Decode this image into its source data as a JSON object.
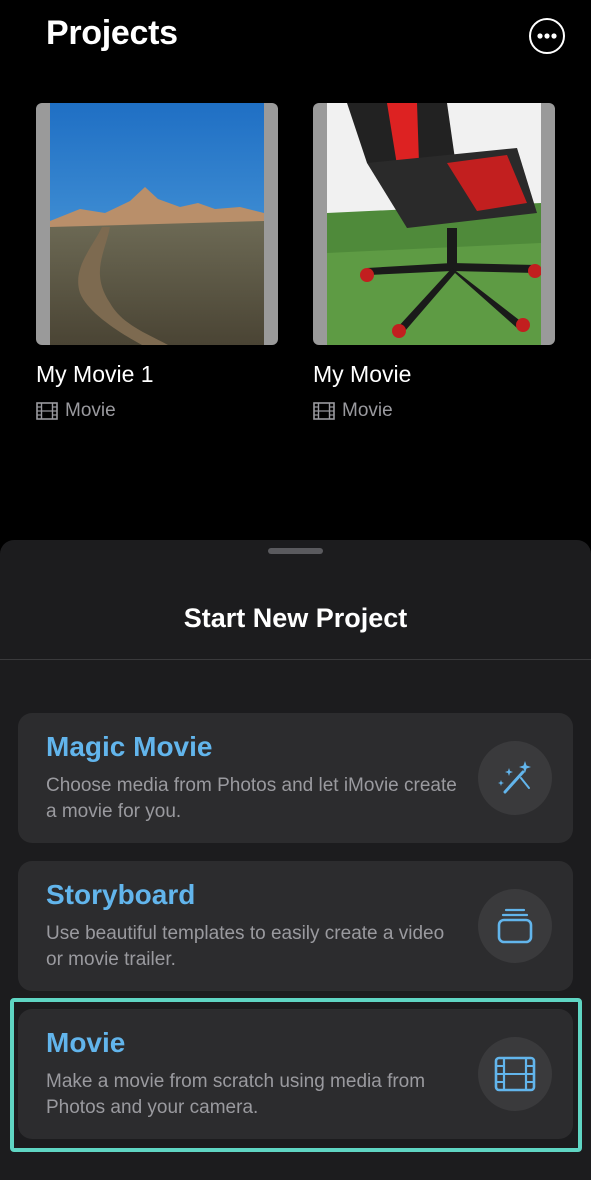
{
  "header": {
    "title": "Projects"
  },
  "projects": [
    {
      "name": "My Movie 1",
      "type": "Movie"
    },
    {
      "name": "My Movie",
      "type": "Movie"
    }
  ],
  "sheet": {
    "title": "Start New Project",
    "options": [
      {
        "title": "Magic Movie",
        "description": "Choose media from Photos and let iMovie create a movie for you.",
        "icon": "magic-wand-icon"
      },
      {
        "title": "Storyboard",
        "description": "Use beautiful templates to easily create a video or movie trailer.",
        "icon": "stack-icon"
      },
      {
        "title": "Movie",
        "description": "Make a movie from scratch using media from Photos and your camera.",
        "icon": "film-icon"
      }
    ]
  },
  "colors": {
    "accent": "#62b5ec",
    "highlight": "#5fd5c3",
    "sheet_bg": "#1c1c1e",
    "card_bg": "#2c2c2e"
  }
}
